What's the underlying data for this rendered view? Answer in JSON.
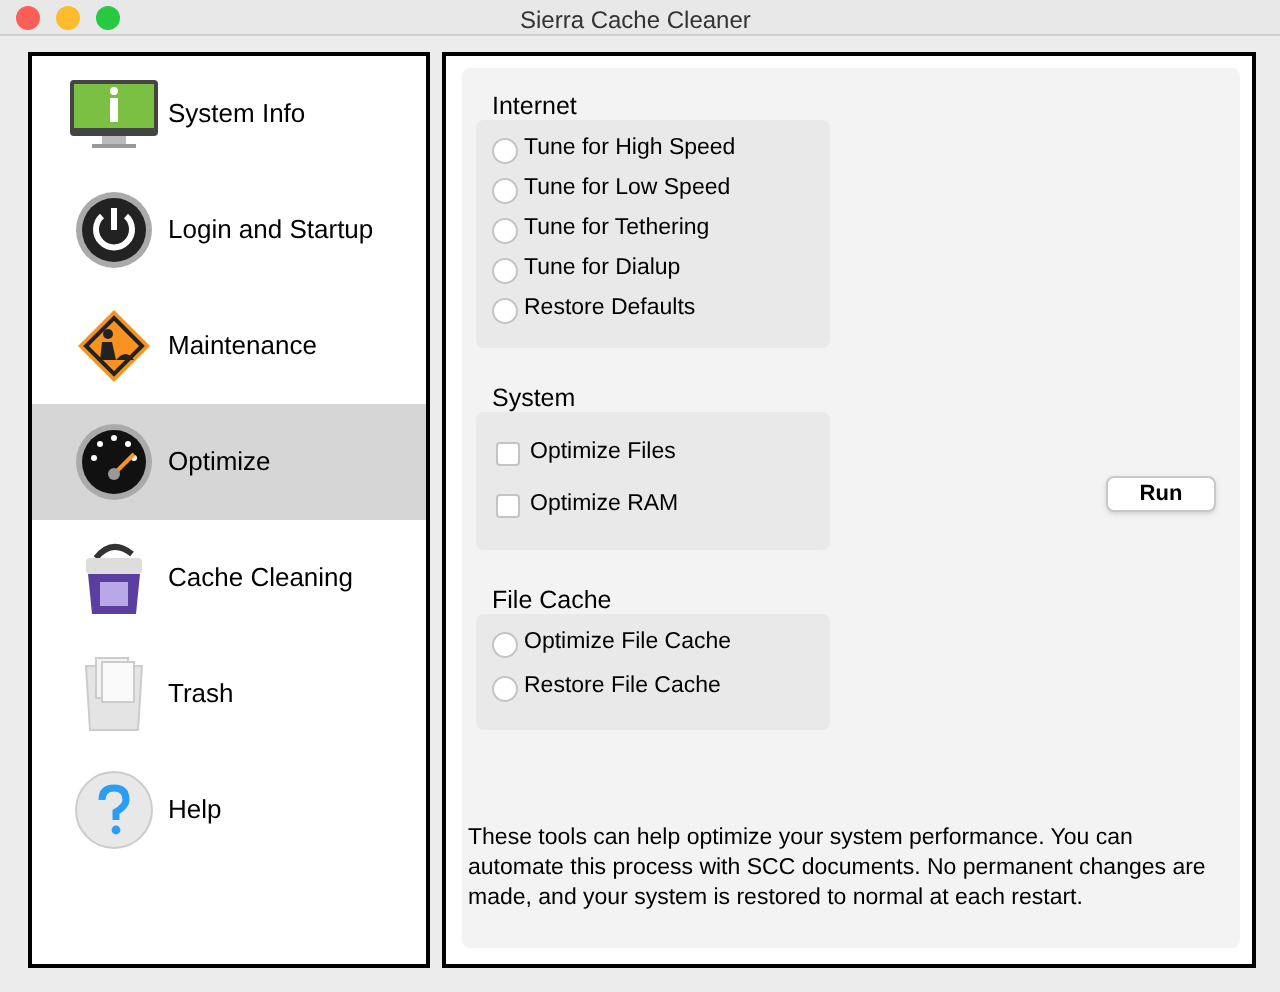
{
  "window": {
    "title": "Sierra Cache Cleaner"
  },
  "sidebar": {
    "items": [
      {
        "label": "System Info",
        "selected": false
      },
      {
        "label": "Login and Startup",
        "selected": false
      },
      {
        "label": "Maintenance",
        "selected": false
      },
      {
        "label": "Optimize",
        "selected": true
      },
      {
        "label": "Cache Cleaning",
        "selected": false
      },
      {
        "label": "Trash",
        "selected": false
      },
      {
        "label": "Help",
        "selected": false
      }
    ]
  },
  "groups": [
    {
      "title": "Internet",
      "options": [
        {
          "kind": "radio",
          "label": "Tune for High Speed",
          "checked": false
        },
        {
          "kind": "radio",
          "label": "Tune for Low Speed",
          "checked": false
        },
        {
          "kind": "radio",
          "label": "Tune for Tethering",
          "checked": false
        },
        {
          "kind": "radio",
          "label": "Tune for Dialup",
          "checked": false
        },
        {
          "kind": "radio",
          "label": "Restore Defaults",
          "checked": false
        }
      ]
    },
    {
      "title": "System",
      "options": [
        {
          "kind": "checkbox",
          "label": "Optimize Files",
          "checked": false
        },
        {
          "kind": "checkbox",
          "label": "Optimize RAM",
          "checked": false
        }
      ]
    },
    {
      "title": "File Cache",
      "options": [
        {
          "kind": "radio",
          "label": "Optimize File Cache",
          "checked": false
        },
        {
          "kind": "radio",
          "label": "Restore File Cache",
          "checked": false
        }
      ]
    }
  ],
  "run_button": "Run",
  "description": "These tools can help optimize your system performance.  You can automate this process with SCC documents.  No permanent changes are made, and your system is restored to normal at each restart."
}
